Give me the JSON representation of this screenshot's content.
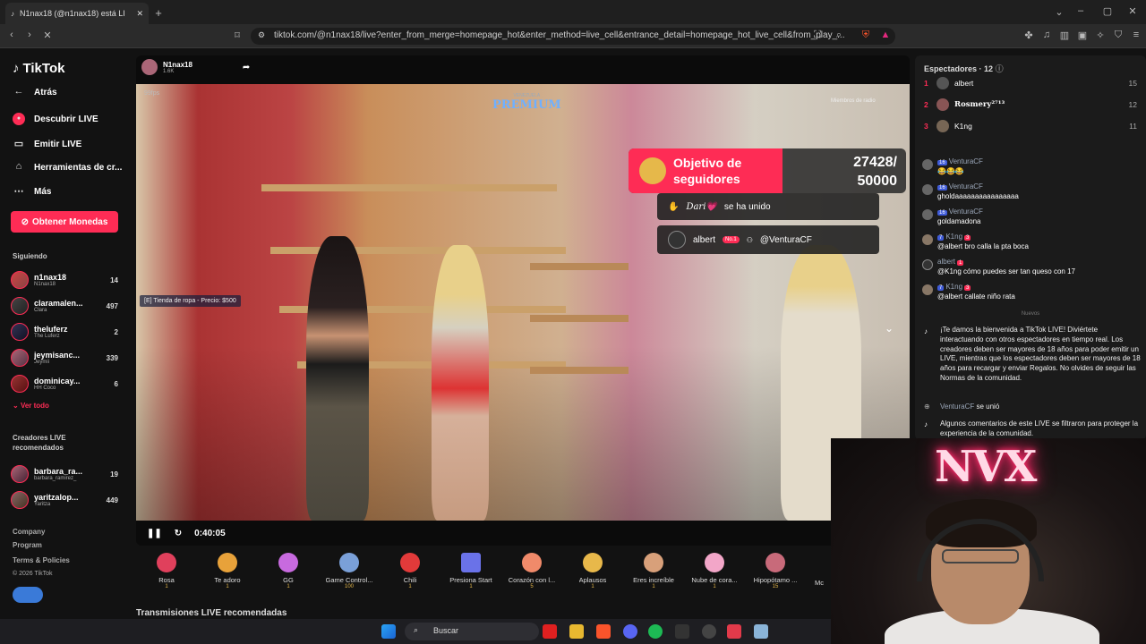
{
  "browser": {
    "tab_title": "N1nax18 (@n1nax18) está LI",
    "new_tab": "+",
    "url": "tiktok.com/@n1nax18/live?enter_from_merge=homepage_hot&enter_method=live_cell&entrance_detail=homepage_hot_live_cell&from_play_..."
  },
  "sidebar": {
    "logo": "TikTok",
    "nav": [
      {
        "label": "Atrás",
        "icon": "back-arrow-icon"
      },
      {
        "label": "Descubrir LIVE",
        "icon": "live-icon"
      },
      {
        "label": "Emitir LIVE",
        "icon": "camera-icon"
      },
      {
        "label": "Herramientas de cr...",
        "icon": "home-icon"
      },
      {
        "label": "Más",
        "icon": "more-icon"
      }
    ],
    "coins_button": "Obtener Monedas",
    "following_label": "Siguiendo",
    "following": [
      {
        "name": "n1nax18",
        "sub": "N1nax18",
        "count": "14"
      },
      {
        "name": "claramalen...",
        "sub": "Clara",
        "count": "497"
      },
      {
        "name": "theluferz",
        "sub": "The Luferz",
        "count": "2"
      },
      {
        "name": "jeymisanc...",
        "sub": "Jeymii",
        "count": "339"
      },
      {
        "name": "dominicay...",
        "sub": "HH Coco",
        "count": "6"
      }
    ],
    "see_all": "Ver todo",
    "recommended_label": "Creadores LIVE recomendados",
    "recommended": [
      {
        "name": "barbara_ra...",
        "sub": "barbara_ramirez_",
        "count": "19"
      },
      {
        "name": "yaritzalop...",
        "sub": "Yaritza",
        "count": "449"
      }
    ],
    "footer": [
      "Company",
      "Program",
      "Terms & Policies",
      "© 2026 TikTok"
    ]
  },
  "stream": {
    "host_name": "N1nax18",
    "host_likes": "1.6K",
    "fps": "99fps",
    "server_logo": "PREMIUM",
    "server_logo_top": "VENEZUELA",
    "radio_label": "Miembros de radio",
    "store_hint": "[E] Tienda de ropa - Precio: $500",
    "goal_title": "Objetivo de seguidores",
    "goal_count": "27428/",
    "goal_target": "50000",
    "join_user": "Dari💗",
    "join_text": "se ha unido",
    "gift_user": "albert",
    "gift_badge": "No.1",
    "gift_target": "@VenturaCF",
    "time": "0:40:05"
  },
  "gifts": [
    {
      "name": "Rosa",
      "price": "1",
      "color": "#e0405c"
    },
    {
      "name": "Te adoro",
      "price": "1",
      "color": "#e8a23a"
    },
    {
      "name": "GG",
      "price": "1",
      "color": "#c86adf"
    },
    {
      "name": "Game Control...",
      "price": "100",
      "color": "#7aa0d8"
    },
    {
      "name": "Chili",
      "price": "1",
      "color": "#e23a3a"
    },
    {
      "name": "Presiona Start",
      "price": "1",
      "color": "#6a72e8"
    },
    {
      "name": "Corazón con l...",
      "price": "5",
      "color": "#f08a6a"
    },
    {
      "name": "Aplausos",
      "price": "1",
      "color": "#e8b84a"
    },
    {
      "name": "Eres increíble",
      "price": "1",
      "color": "#d8a07a"
    },
    {
      "name": "Nube de cora...",
      "price": "1",
      "color": "#f2a6c8"
    },
    {
      "name": "Hipopótamo ...",
      "price": "15",
      "color": "#c86a7a"
    }
  ],
  "gifts_more": "Mc",
  "recommended_title": "Transmisiones LIVE recomendadas",
  "chat": {
    "viewers_label": "Espectadores · 12",
    "top_viewers": [
      {
        "rank": "1",
        "name": "albert",
        "score": "15"
      },
      {
        "rank": "2",
        "name": "Rosmery²⁷¹³",
        "score": "12"
      },
      {
        "rank": "3",
        "name": "K1ng",
        "score": "11"
      }
    ],
    "messages": [
      {
        "level": "16",
        "user": "VenturaCF",
        "text": "😂😂😂"
      },
      {
        "level": "16",
        "user": "VenturaCF",
        "text": "gholdaaaaaaaaaaaaaaaa"
      },
      {
        "level": "16",
        "user": "VenturaCF",
        "text": "goldamadona"
      },
      {
        "level": "7",
        "user": "K1ng",
        "fan": "3",
        "text": "@albert bro calla la pta boca"
      },
      {
        "level": "",
        "user": "albert",
        "fan": "1",
        "text": "@K1ng cómo puedes ser tan queso con 17"
      },
      {
        "level": "7",
        "user": "K1ng",
        "fan": "3",
        "text": "@albert callate niño rata"
      }
    ],
    "divider": "Nuevos",
    "welcome": "¡Te damos la bienvenida a TikTok LIVE! Diviértete interactuando con otros espectadores en tiempo real. Los creadores deben ser mayores de 18 años para poder emitir un LIVE, mientras que los espectadores deben ser mayores de 18 años para recargar y enviar Regalos. No olvides de seguir las Normas de la comunidad.",
    "joined_user": "VenturaCF",
    "joined_text": "se unió",
    "filtered_notice": "Algunos comentarios de este LIVE se filtraron para proteger la experiencia de la comunidad."
  },
  "webcam": {
    "sign": "NVX"
  },
  "taskbar": {
    "search": "Buscar"
  }
}
